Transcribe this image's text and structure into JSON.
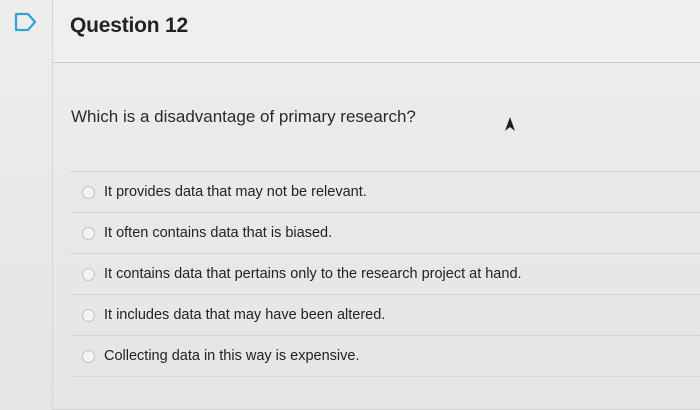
{
  "question": {
    "title": "Question 12",
    "prompt": "Which is a disadvantage of primary research?",
    "options": [
      {
        "label": "It provides data that may not be relevant."
      },
      {
        "label": "It often contains data that is biased."
      },
      {
        "label": "It contains data that pertains only to the research project at hand."
      },
      {
        "label": "It includes data that may have been altered."
      },
      {
        "label": "Collecting data in this way is expensive."
      }
    ]
  },
  "icons": {
    "flag": "flag-icon",
    "cursor": "mouse-pointer-icon"
  },
  "colors": {
    "accent": "#2aa6d9",
    "radio_border": "#b9c7b4"
  }
}
